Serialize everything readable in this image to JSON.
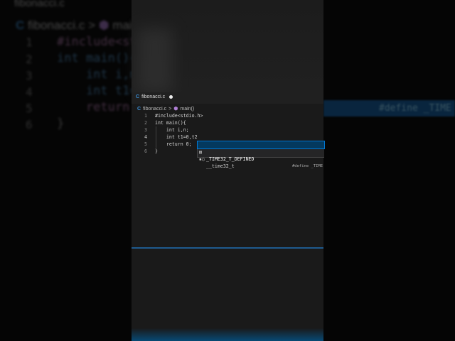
{
  "editor": {
    "tab": {
      "filename": "fibonacci.c",
      "file_icon": "c-file-icon",
      "unsaved": true
    },
    "breadcrumb": {
      "file": "fibonacci.c",
      "separator": ">",
      "symbol": "main()"
    },
    "lines": [
      {
        "number": "1",
        "text": "#include<stdio.h>"
      },
      {
        "number": "2",
        "text": "int main(){"
      },
      {
        "number": "3",
        "text": "    int i,n;"
      },
      {
        "number": "4",
        "text": "    int t1=0,t2"
      },
      {
        "number": "5",
        "text": "    return 0;"
      },
      {
        "number": "6",
        "text": "}"
      }
    ],
    "suggestions": [
      {
        "icon": "constant-icon",
        "label": "_TIME32_T_DEFINED",
        "detail": "#define _TIME",
        "selected": true
      },
      {
        "icon": "typedef-icon",
        "label": "__time32_t",
        "detail": "",
        "selected": false
      }
    ]
  },
  "background_echo": {
    "define_text": "#define _TIME"
  },
  "colors": {
    "accent": "#0078d4",
    "selection": "#04395e",
    "keyword": "#569cd6"
  }
}
